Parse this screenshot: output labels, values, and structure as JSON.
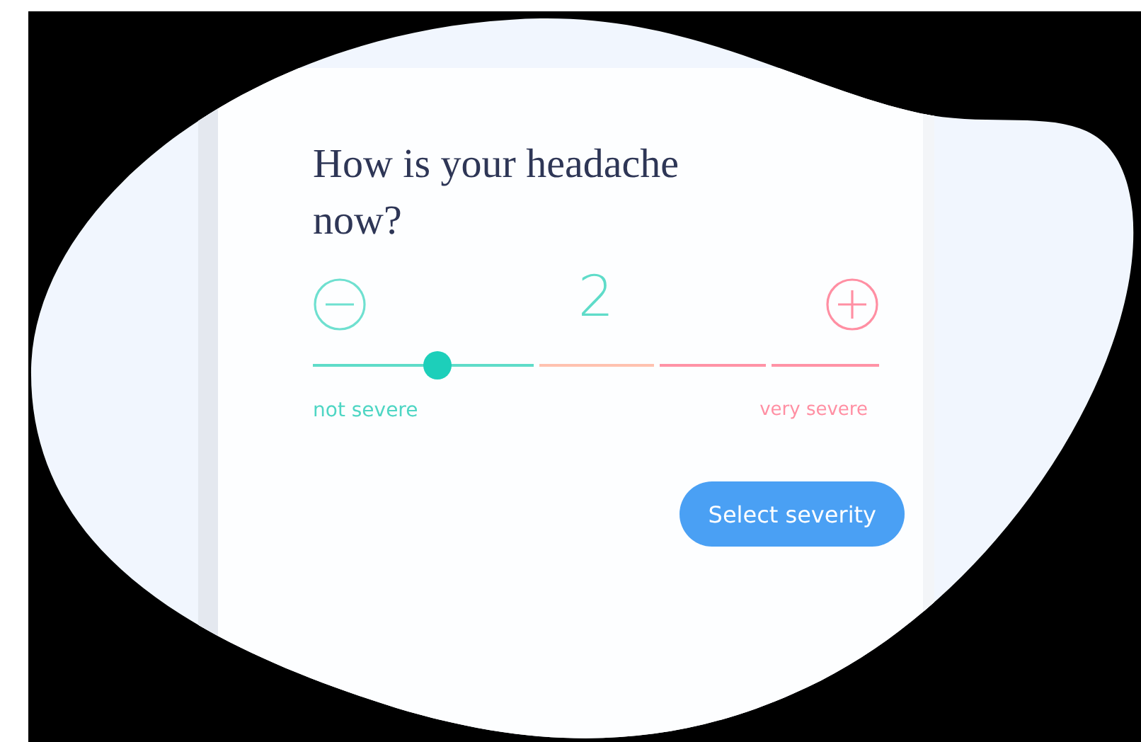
{
  "question": "How is your headache now?",
  "severity": {
    "value": "2",
    "level": 0.22,
    "segments": [
      {
        "color": "#5fdcc9"
      },
      {
        "color": "#ffc2b0"
      },
      {
        "color": "#ff93a6"
      },
      {
        "color": "#ff93a6"
      }
    ],
    "low_label": "not severe",
    "high_label": "very severe"
  },
  "button": "Select severity"
}
